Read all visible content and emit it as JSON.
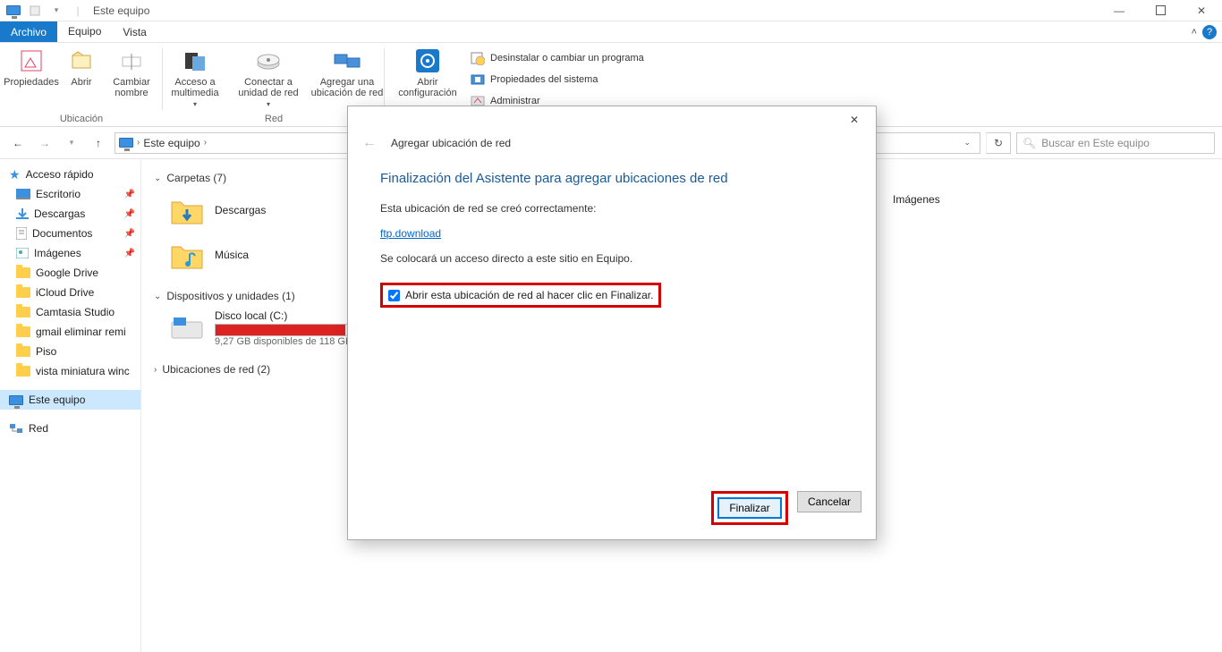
{
  "window": {
    "title": "Este equipo"
  },
  "ribbonTabs": {
    "archivo": "Archivo",
    "equipo": "Equipo",
    "vista": "Vista"
  },
  "ribbon": {
    "group1_label": "Ubicación",
    "propiedades": "Propiedades",
    "abrir": "Abrir",
    "cambiar_nombre": "Cambiar nombre",
    "group2_label": "Red",
    "acceso_multimedia": "Acceso a multimedia",
    "conectar_unidad": "Conectar a unidad de red",
    "agregar_ubicacion": "Agregar una ubicación de red",
    "abrir_config": "Abrir configuración",
    "desinstalar": "Desinstalar o cambiar un programa",
    "prop_sistema": "Propiedades del sistema",
    "administrar": "Administrar"
  },
  "nav": {
    "breadcrumb": "Este equipo",
    "search_placeholder": "Buscar en Este equipo"
  },
  "sidebar": {
    "quick": "Acceso rápido",
    "items": [
      {
        "label": "Escritorio",
        "pin": true,
        "icon": "desktop"
      },
      {
        "label": "Descargas",
        "pin": true,
        "icon": "downloads"
      },
      {
        "label": "Documentos",
        "pin": true,
        "icon": "documents"
      },
      {
        "label": "Imágenes",
        "pin": true,
        "icon": "pictures"
      },
      {
        "label": "Google Drive",
        "pin": false,
        "icon": "folder"
      },
      {
        "label": "iCloud Drive",
        "pin": false,
        "icon": "folder"
      },
      {
        "label": "Camtasia Studio",
        "pin": false,
        "icon": "folder"
      },
      {
        "label": "gmail eliminar remi",
        "pin": false,
        "icon": "folder"
      },
      {
        "label": "Piso",
        "pin": false,
        "icon": "folder"
      },
      {
        "label": "vista miniatura winc",
        "pin": false,
        "icon": "folder"
      }
    ],
    "este_equipo": "Este equipo",
    "red": "Red"
  },
  "content": {
    "carpetas_head": "Carpetas (7)",
    "descargas": "Descargas",
    "musica": "Música",
    "imagenes": "Imágenes",
    "dispositivos_head": "Dispositivos y unidades (1)",
    "disco_local": "Disco local (C:)",
    "disco_sub": "9,27 GB disponibles de 118 GB",
    "ubicaciones_head": "Ubicaciones de red (2)"
  },
  "dialog": {
    "wizard_title": "Agregar ubicación de red",
    "heading": "Finalización del Asistente para agregar ubicaciones de red",
    "msg1": "Esta ubicación de red se creó correctamente:",
    "link": "ftp.download",
    "msg2": "Se colocará un acceso directo a este sitio en Equipo.",
    "checkbox_label": "Abrir esta ubicación de red al hacer clic en Finalizar.",
    "finalizar": "Finalizar",
    "cancelar": "Cancelar"
  }
}
